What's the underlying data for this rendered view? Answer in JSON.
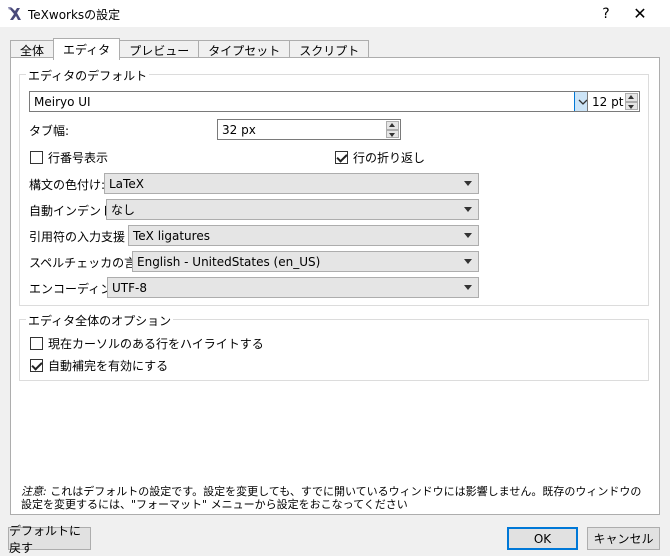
{
  "window": {
    "title": "TeXworksの設定",
    "help_label": "?",
    "close_label": "✕"
  },
  "tabs": [
    {
      "label": "全体",
      "active": false
    },
    {
      "label": "エディタ",
      "active": true
    },
    {
      "label": "プレビュー",
      "active": false
    },
    {
      "label": "タイプセット",
      "active": false
    },
    {
      "label": "スクリプト",
      "active": false
    }
  ],
  "editor_defaults": {
    "group_title": "エディタのデフォルト",
    "font_name": "Meiryo UI",
    "font_size": "12 pt",
    "tab_width_label": "タブ幅:",
    "tab_width_value": "32 px",
    "line_numbers_label": "行番号表示",
    "line_numbers_checked": false,
    "wrap_lines_label": "行の折り返し",
    "wrap_lines_checked": true,
    "syntax_label": "構文の色付け:",
    "syntax_value": "LaTeX",
    "indent_label": "自動インデント:",
    "indent_value": "なし",
    "quotes_label": "引用符の入力支援",
    "quotes_value": "TeX ligatures",
    "spell_label": "スペルチェッカの言語:",
    "spell_value": "English - UnitedStates (en_US)",
    "encoding_label": "エンコーディング:",
    "encoding_value": "UTF-8"
  },
  "editor_global": {
    "group_title": "エディタ全体のオプション",
    "highlight_label": "現在カーソルのある行をハイライトする",
    "highlight_checked": false,
    "autocomplete_label": "自動補完を有効にする",
    "autocomplete_checked": true
  },
  "note": {
    "prefix": "注意:",
    "text": " これはデフォルトの設定です。設定を変更しても、すでに開いているウィンドウには影響しません。既存のウィンドウの設定を変更するには、\"フォーマット\" メニューから設定をおこなってください"
  },
  "buttons": {
    "reset_label": "デフォルトに戻す",
    "ok_label": "OK",
    "cancel_label": "キャンセル"
  },
  "colors": {
    "accent": "#0078d7",
    "background": "#f0f0f0"
  }
}
